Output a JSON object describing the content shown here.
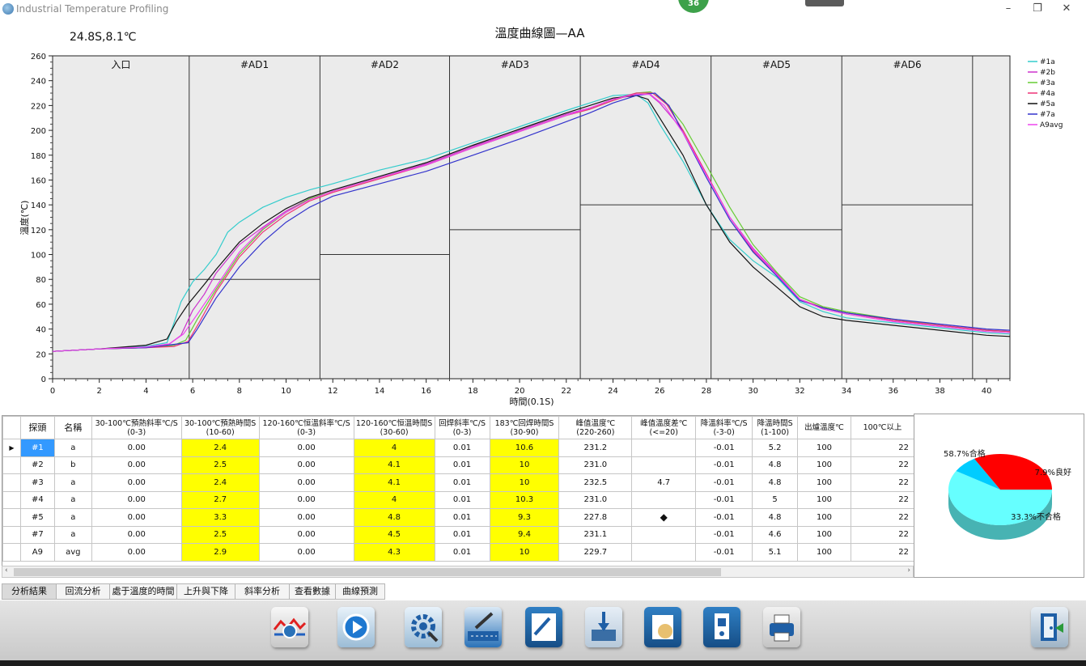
{
  "window": {
    "title": "Industrial Temperature Profiling",
    "badge": "36"
  },
  "chart_data": {
    "type": "line",
    "title": "溫度曲線圖—AA",
    "readout": "24.8S,8.1℃",
    "xlabel": "時間(0.1S)",
    "ylabel": "溫度(℃)",
    "xlim": [
      0,
      41
    ],
    "ylim": [
      0,
      260
    ],
    "xticks": [
      0,
      2,
      4,
      6,
      8,
      10,
      12,
      14,
      16,
      18,
      20,
      22,
      24,
      26,
      28,
      30,
      32,
      34,
      36,
      38,
      40
    ],
    "yticks": [
      0,
      20,
      40,
      60,
      80,
      100,
      120,
      140,
      160,
      180,
      200,
      220,
      240,
      260
    ],
    "zone_boundaries": [
      5.85,
      11.45,
      17.0,
      22.6,
      28.2,
      33.8,
      39.4
    ],
    "zones": [
      "入口",
      "#AD1",
      "#AD2",
      "#AD3",
      "#AD4",
      "#AD5",
      "#AD6"
    ],
    "zone_setpoints": [
      null,
      80,
      100,
      120,
      140,
      120,
      140
    ],
    "legend": [
      {
        "name": "#1a",
        "color": "#33cccc"
      },
      {
        "name": "#2b",
        "color": "#cc33cc"
      },
      {
        "name": "#3a",
        "color": "#66cc33"
      },
      {
        "name": "#4a",
        "color": "#ee3377"
      },
      {
        "name": "#5a",
        "color": "#111111"
      },
      {
        "name": "#7a",
        "color": "#3333cc"
      },
      {
        "name": "A9avg",
        "color": "#ee44ee"
      }
    ],
    "series": [
      {
        "name": "#1a",
        "color": "#33cccc",
        "points": [
          [
            0,
            22
          ],
          [
            2,
            24
          ],
          [
            4,
            26
          ],
          [
            4.9,
            29
          ],
          [
            5.2,
            45
          ],
          [
            5.5,
            62
          ],
          [
            6,
            78
          ],
          [
            6.5,
            88
          ],
          [
            7,
            100
          ],
          [
            7.5,
            118
          ],
          [
            8,
            126
          ],
          [
            9,
            138
          ],
          [
            10,
            146
          ],
          [
            11,
            152
          ],
          [
            12,
            157
          ],
          [
            14,
            168
          ],
          [
            16,
            177
          ],
          [
            18,
            190
          ],
          [
            20,
            203
          ],
          [
            22,
            216
          ],
          [
            23,
            222
          ],
          [
            24,
            228
          ],
          [
            25,
            229
          ],
          [
            25.5,
            222
          ],
          [
            26,
            205
          ],
          [
            27,
            175
          ],
          [
            28,
            140
          ],
          [
            29,
            112
          ],
          [
            30,
            95
          ],
          [
            31,
            82
          ],
          [
            32,
            62
          ],
          [
            33,
            54
          ],
          [
            34,
            49
          ],
          [
            36,
            45
          ],
          [
            38,
            41
          ],
          [
            40,
            37
          ],
          [
            41,
            36
          ]
        ]
      },
      {
        "name": "#2b",
        "color": "#cc33cc",
        "points": [
          [
            0,
            22
          ],
          [
            2,
            24
          ],
          [
            4,
            25
          ],
          [
            5,
            28
          ],
          [
            5.5,
            35
          ],
          [
            6,
            55
          ],
          [
            6.5,
            68
          ],
          [
            7,
            85
          ],
          [
            8,
            108
          ],
          [
            9,
            122
          ],
          [
            10,
            135
          ],
          [
            11,
            145
          ],
          [
            12,
            151
          ],
          [
            14,
            162
          ],
          [
            16,
            173
          ],
          [
            18,
            187
          ],
          [
            20,
            200
          ],
          [
            22,
            213
          ],
          [
            23,
            218
          ],
          [
            24,
            225
          ],
          [
            25,
            230
          ],
          [
            25.5,
            230
          ],
          [
            26,
            222
          ],
          [
            27,
            200
          ],
          [
            28,
            165
          ],
          [
            29,
            130
          ],
          [
            30,
            105
          ],
          [
            31,
            85
          ],
          [
            32,
            64
          ],
          [
            33,
            57
          ],
          [
            34,
            53
          ],
          [
            36,
            47
          ],
          [
            38,
            43
          ],
          [
            40,
            39
          ],
          [
            41,
            38
          ]
        ]
      },
      {
        "name": "#3a",
        "color": "#66cc33",
        "points": [
          [
            0,
            22
          ],
          [
            2,
            24
          ],
          [
            4,
            25
          ],
          [
            5.2,
            27
          ],
          [
            5.7,
            31
          ],
          [
            6.2,
            48
          ],
          [
            7,
            72
          ],
          [
            8,
            100
          ],
          [
            9,
            120
          ],
          [
            10,
            134
          ],
          [
            11,
            145
          ],
          [
            12,
            151
          ],
          [
            14,
            162
          ],
          [
            16,
            172
          ],
          [
            18,
            186
          ],
          [
            20,
            199
          ],
          [
            22,
            212
          ],
          [
            23,
            217
          ],
          [
            24,
            224
          ],
          [
            25,
            230
          ],
          [
            25.6,
            231
          ],
          [
            26.2,
            224
          ],
          [
            27,
            205
          ],
          [
            28,
            172
          ],
          [
            29,
            138
          ],
          [
            30,
            108
          ],
          [
            31,
            86
          ],
          [
            32,
            66
          ],
          [
            33,
            58
          ],
          [
            34,
            54
          ],
          [
            36,
            48
          ],
          [
            38,
            43
          ],
          [
            40,
            39
          ],
          [
            41,
            38
          ]
        ]
      },
      {
        "name": "#4a",
        "color": "#ee3377",
        "points": [
          [
            0,
            22
          ],
          [
            2,
            24
          ],
          [
            4,
            25
          ],
          [
            5.2,
            26
          ],
          [
            5.8,
            30
          ],
          [
            6.3,
            46
          ],
          [
            7,
            70
          ],
          [
            8,
            98
          ],
          [
            9,
            118
          ],
          [
            10,
            132
          ],
          [
            11,
            143
          ],
          [
            12,
            150
          ],
          [
            14,
            161
          ],
          [
            16,
            172
          ],
          [
            18,
            186
          ],
          [
            20,
            199
          ],
          [
            22,
            212
          ],
          [
            23,
            217
          ],
          [
            24,
            224
          ],
          [
            25,
            230
          ],
          [
            25.7,
            230
          ],
          [
            26.3,
            221
          ],
          [
            27,
            200
          ],
          [
            28,
            165
          ],
          [
            29,
            130
          ],
          [
            30,
            103
          ],
          [
            31,
            84
          ],
          [
            32,
            64
          ],
          [
            33,
            57
          ],
          [
            34,
            53
          ],
          [
            36,
            47
          ],
          [
            38,
            43
          ],
          [
            40,
            39
          ],
          [
            41,
            38
          ]
        ]
      },
      {
        "name": "#5a",
        "color": "#111111",
        "points": [
          [
            0,
            22
          ],
          [
            2,
            24
          ],
          [
            4,
            27
          ],
          [
            4.9,
            32
          ],
          [
            5.3,
            46
          ],
          [
            5.8,
            60
          ],
          [
            6.5,
            76
          ],
          [
            7,
            88
          ],
          [
            8,
            110
          ],
          [
            9,
            125
          ],
          [
            10,
            137
          ],
          [
            11,
            146
          ],
          [
            12,
            152
          ],
          [
            14,
            163
          ],
          [
            16,
            174
          ],
          [
            18,
            188
          ],
          [
            20,
            201
          ],
          [
            22,
            214
          ],
          [
            23,
            220
          ],
          [
            24,
            226
          ],
          [
            25,
            228
          ],
          [
            25.5,
            225
          ],
          [
            26,
            210
          ],
          [
            27,
            180
          ],
          [
            28,
            140
          ],
          [
            29,
            110
          ],
          [
            30,
            90
          ],
          [
            31,
            74
          ],
          [
            32,
            58
          ],
          [
            33,
            50
          ],
          [
            34,
            47
          ],
          [
            36,
            43
          ],
          [
            38,
            39
          ],
          [
            40,
            35
          ],
          [
            41,
            34
          ]
        ]
      },
      {
        "name": "#7a",
        "color": "#3333cc",
        "points": [
          [
            0,
            22
          ],
          [
            2,
            24
          ],
          [
            4,
            25
          ],
          [
            5.8,
            29
          ],
          [
            6.2,
            40
          ],
          [
            7,
            65
          ],
          [
            8,
            90
          ],
          [
            9,
            110
          ],
          [
            10,
            126
          ],
          [
            11,
            138
          ],
          [
            12,
            147
          ],
          [
            14,
            157
          ],
          [
            16,
            167
          ],
          [
            18,
            180
          ],
          [
            20,
            193
          ],
          [
            22,
            207
          ],
          [
            23,
            214
          ],
          [
            24,
            222
          ],
          [
            25,
            228
          ],
          [
            25.8,
            230
          ],
          [
            26.4,
            220
          ],
          [
            27,
            198
          ],
          [
            28,
            162
          ],
          [
            29,
            128
          ],
          [
            30,
            102
          ],
          [
            31,
            83
          ],
          [
            32,
            63
          ],
          [
            33,
            57
          ],
          [
            34,
            53
          ],
          [
            36,
            48
          ],
          [
            38,
            44
          ],
          [
            40,
            40
          ],
          [
            41,
            39
          ]
        ]
      },
      {
        "name": "A9avg",
        "color": "#ee44ee",
        "points": [
          [
            0,
            22
          ],
          [
            2,
            24
          ],
          [
            4,
            25.5
          ],
          [
            5,
            28
          ],
          [
            5.6,
            36
          ],
          [
            6.2,
            52
          ],
          [
            7,
            74
          ],
          [
            8,
            102
          ],
          [
            9,
            121
          ],
          [
            10,
            134
          ],
          [
            11,
            144
          ],
          [
            12,
            151
          ],
          [
            14,
            162
          ],
          [
            16,
            172
          ],
          [
            18,
            186
          ],
          [
            20,
            199
          ],
          [
            22,
            212
          ],
          [
            23,
            218
          ],
          [
            24,
            225
          ],
          [
            25,
            229
          ],
          [
            25.6,
            229
          ],
          [
            26.2,
            220
          ],
          [
            27,
            198
          ],
          [
            28,
            164
          ],
          [
            29,
            130
          ],
          [
            30,
            104
          ],
          [
            31,
            84
          ],
          [
            32,
            64
          ],
          [
            33,
            56
          ],
          [
            34,
            52
          ],
          [
            36,
            46
          ],
          [
            38,
            42
          ],
          [
            40,
            38
          ],
          [
            41,
            37
          ]
        ]
      }
    ]
  },
  "table": {
    "headers": [
      "探頭",
      "名稱",
      "30-100℃預熱斜率℃/S\n(0-3)",
      "30-100℃預熱時間S\n(10-60)",
      "120-160℃恒溫斜率℃/S\n(0-3)",
      "120-160℃恒溫時間S\n(30-60)",
      "回焊斜率℃/S\n(0-3)",
      "183℃回焊時間S\n(30-90)",
      "峰值溫度℃\n(220-260)",
      "峰值溫度差℃\n(<=20)",
      "降溫斜率℃/S\n(-3-0)",
      "降溫時間S\n(1-100)",
      "出爐溫度℃",
      "100℃以上"
    ],
    "rows": [
      [
        "#1",
        "a",
        "0.00",
        "2.4",
        "0.00",
        "4",
        "0.01",
        "10.6",
        "231.2",
        "",
        "-0.01",
        "5.2",
        "100",
        "22"
      ],
      [
        "#2",
        "b",
        "0.00",
        "2.5",
        "0.00",
        "4.1",
        "0.01",
        "10",
        "231.0",
        "",
        "-0.01",
        "4.8",
        "100",
        "22"
      ],
      [
        "#3",
        "a",
        "0.00",
        "2.4",
        "0.00",
        "4.1",
        "0.01",
        "10",
        "232.5",
        "4.7",
        "-0.01",
        "4.8",
        "100",
        "22"
      ],
      [
        "#4",
        "a",
        "0.00",
        "2.7",
        "0.00",
        "4",
        "0.01",
        "10.3",
        "231.0",
        "",
        "-0.01",
        "5",
        "100",
        "22"
      ],
      [
        "#5",
        "a",
        "0.00",
        "3.3",
        "0.00",
        "4.8",
        "0.01",
        "9.3",
        "227.8",
        "◆",
        "-0.01",
        "4.8",
        "100",
        "22"
      ],
      [
        "#7",
        "a",
        "0.00",
        "2.5",
        "0.00",
        "4.5",
        "0.01",
        "9.4",
        "231.1",
        "",
        "-0.01",
        "4.6",
        "100",
        "22"
      ],
      [
        "A9",
        "avg",
        "0.00",
        "2.9",
        "0.00",
        "4.3",
        "0.01",
        "10",
        "229.7",
        "",
        "-0.01",
        "5.1",
        "100",
        "22"
      ]
    ],
    "current_row_marker": "▶"
  },
  "pie_chart": {
    "type": "pie",
    "slices": [
      {
        "label": "58.7%合格",
        "value": 58.7,
        "color": "#66ffff"
      },
      {
        "label": "7.9%良好",
        "value": 7.9,
        "color": "#00ccff"
      },
      {
        "label": "33.3%不合格",
        "value": 33.3,
        "color": "#ff0000"
      }
    ]
  },
  "tabs": [
    "分析結果",
    "回流分析",
    "處于溫度的時間",
    "上升與下降",
    "斜率分析",
    "查看數據",
    "曲線預測"
  ],
  "toolbar": [
    {
      "name": "profile-analysis-icon"
    },
    {
      "name": "play-icon"
    },
    {
      "name": "settings-search-icon"
    },
    {
      "name": "edit-conveyor-icon"
    },
    {
      "name": "edit-document-icon"
    },
    {
      "name": "download-data-icon"
    },
    {
      "name": "hand-open-file-icon"
    },
    {
      "name": "probe-device-icon"
    },
    {
      "name": "print-curve-icon"
    },
    {
      "name": "exit-door-icon"
    }
  ]
}
